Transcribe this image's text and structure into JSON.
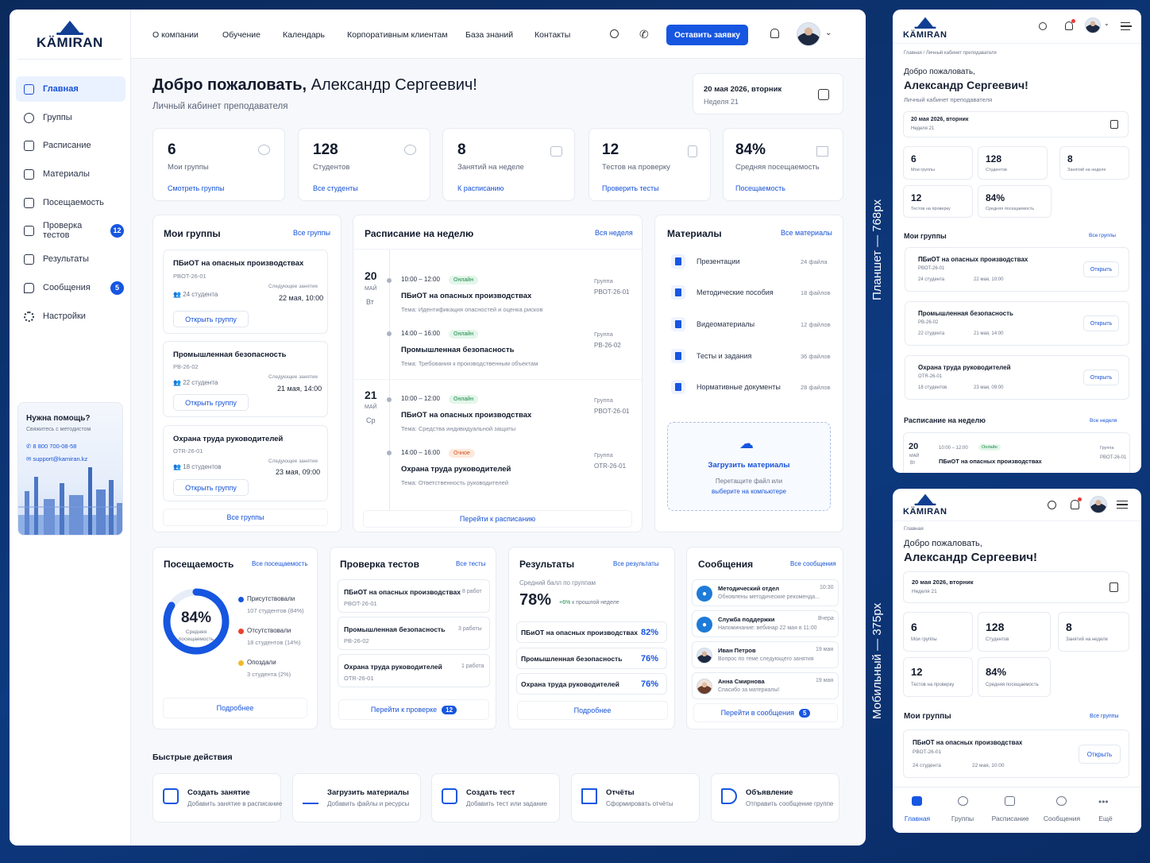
{
  "brand": {
    "name": "KÄMIRAN",
    "accent": "#1656e0"
  },
  "desktop": {
    "sidebar": {
      "items": [
        {
          "label": "Главная",
          "icon": "home-icon"
        },
        {
          "label": "Группы",
          "icon": "users-icon"
        },
        {
          "label": "Расписание",
          "icon": "calendar-icon"
        },
        {
          "label": "Материалы",
          "icon": "folder-icon"
        },
        {
          "label": "Посещаемость",
          "icon": "clipboard-icon"
        },
        {
          "label": "Проверка тестов",
          "icon": "check-square-icon",
          "badge": "12"
        },
        {
          "label": "Результаты",
          "icon": "bar-chart-icon"
        },
        {
          "label": "Сообщения",
          "icon": "chat-icon",
          "badge": "5"
        },
        {
          "label": "Настройки",
          "icon": "gear-icon"
        }
      ],
      "help": {
        "title": "Нужна помощь?",
        "subtitle": "Свяжитесь с методистом",
        "phone": "8 800 700-08-58",
        "email": "support@kamiran.kz"
      }
    },
    "topnav": {
      "links": [
        "О компании",
        "Обучение",
        "Календарь",
        "Корпоративным клиентам",
        "База знаний",
        "Контакты"
      ],
      "cta": "Оставить заявку"
    },
    "welcome": {
      "greeting": "Добро пожаловать,",
      "name": "Александр Сергеевич!",
      "subtitle": "Личный кабинет преподавателя"
    },
    "date": {
      "line1": "20 мая 2026, вторник",
      "line2": "Неделя 21"
    },
    "stats": [
      {
        "value": "6",
        "label": "Мои группы",
        "link": "Смотреть группы"
      },
      {
        "value": "128",
        "label": "Студентов",
        "link": "Все студенты"
      },
      {
        "value": "8",
        "label": "Занятий на неделе",
        "link": "К расписанию"
      },
      {
        "value": "12",
        "label": "Тестов на проверку",
        "link": "Проверить тесты"
      },
      {
        "value": "84%",
        "label": "Средняя посещаемость",
        "link": "Посещаемость"
      }
    ],
    "groups": {
      "title": "Мои группы",
      "all": "Все группы",
      "items": [
        {
          "name": "ПБиОТ на опасных производствах",
          "code": "PBOT-26-01",
          "students": "24 студента",
          "next_label": "Следующее занятие",
          "next": "22 мая, 10:00",
          "btn": "Открыть группу"
        },
        {
          "name": "Промышленная безопасность",
          "code": "PB-26-02",
          "students": "22 студента",
          "next_label": "Следующее занятие",
          "next": "21 мая, 14:00",
          "btn": "Открыть группу"
        },
        {
          "name": "Охрана труда руководителей",
          "code": "OTR-26-01",
          "students": "18 студентов",
          "next_label": "Следующее занятие",
          "next": "23 мая, 09:00",
          "btn": "Открыть группу"
        }
      ],
      "footer": "Все группы"
    },
    "schedule": {
      "title": "Расписание на неделю",
      "all": "Вся неделя",
      "days": [
        {
          "day": "20",
          "month": "МАЙ",
          "wd": "Вт",
          "lessons": [
            {
              "time": "10:00 – 12:00",
              "mode": "Онлайн",
              "title": "ПБиОТ на опасных производствах",
              "topic": "Тема: Идентификация опасностей и оценка рисков",
              "group_label": "Группа",
              "group": "PBOT-26-01"
            },
            {
              "time": "14:00 – 16:00",
              "mode": "Онлайн",
              "title": "Промышленная безопасность",
              "topic": "Тема: Требования к производственным объектам",
              "group_label": "Группа",
              "group": "PB-26-02"
            }
          ]
        },
        {
          "day": "21",
          "month": "МАЙ",
          "wd": "Ср",
          "lessons": [
            {
              "time": "10:00 – 12:00",
              "mode": "Онлайн",
              "title": "ПБиОТ на опасных производствах",
              "topic": "Тема: Средства индивидуальной защиты",
              "group_label": "Группа",
              "group": "PBOT-26-01"
            },
            {
              "time": "14:00 – 16:00",
              "mode": "Очное",
              "title": "Охрана труда руководителей",
              "topic": "Тема: Ответственность руководителей",
              "group_label": "Группа",
              "group": "OTR-26-01"
            }
          ]
        }
      ],
      "footer": "Перейти к расписанию"
    },
    "materials": {
      "title": "Материалы",
      "all": "Все материалы",
      "items": [
        {
          "name": "Презентации",
          "count": "24 файла"
        },
        {
          "name": "Методические пособия",
          "count": "18 файлов"
        },
        {
          "name": "Видеоматериалы",
          "count": "12 файлов"
        },
        {
          "name": "Тесты и задания",
          "count": "36 файлов"
        },
        {
          "name": "Нормативные документы",
          "count": "28 файлов"
        }
      ],
      "upload_title": "Загрузить материалы",
      "upload_hint1": "Перетащите файл или",
      "upload_hint2": "выберите на компьютере"
    },
    "attendance": {
      "title": "Посещаемость",
      "all": "Все посещаемость",
      "percent": "84%",
      "percent_value": 84,
      "center_label1": "Средняя",
      "center_label2": "посещаемость",
      "legend": [
        {
          "name": "Присутствовали",
          "detail": "107 студентов (84%)",
          "color": "#1656e0"
        },
        {
          "name": "Отсутствовали",
          "detail": "18 студентов (14%)",
          "color": "#e8412e"
        },
        {
          "name": "Опоздали",
          "detail": "3 студента (2%)",
          "color": "#f2b92b"
        }
      ],
      "footer": "Подробнее"
    },
    "tests": {
      "title": "Проверка тестов",
      "all": "Все тесты",
      "items": [
        {
          "name": "ПБиОТ на опасных производствах",
          "code": "PBOT-26-01",
          "count": "8 работ"
        },
        {
          "name": "Промышленная безопасность",
          "code": "PB-26-02",
          "count": "3 работы"
        },
        {
          "name": "Охрана труда руководителей",
          "code": "OTR-26-01",
          "count": "1 работа"
        }
      ],
      "footer": "Перейти к проверке",
      "footer_badge": "12"
    },
    "results": {
      "title": "Результаты",
      "all": "Все результаты",
      "avg_label": "Средний балл по группам",
      "avg": "78%",
      "delta": "+6%",
      "delta_label": "к прошлой неделе",
      "items": [
        {
          "name": "ПБиОТ на опасных производствах",
          "pct": "82%"
        },
        {
          "name": "Промышленная безопасность",
          "pct": "76%"
        },
        {
          "name": "Охрана труда руководителей",
          "pct": "76%"
        }
      ],
      "footer": "Подробнее"
    },
    "messages": {
      "title": "Сообщения",
      "all": "Все сообщения",
      "items": [
        {
          "from": "Методический отдел",
          "time": "10:30",
          "text": "Обновлены методические рекоменда..."
        },
        {
          "from": "Служба поддержки",
          "time": "Вчера",
          "text": "Напоминание: вебинар 22 мая в 11:00"
        },
        {
          "from": "Иван Петров",
          "time": "19 мая",
          "text": "Вопрос по теме следующего занятия"
        },
        {
          "from": "Анна Смирнова",
          "time": "19 мая",
          "text": "Спасибо за материалы!"
        }
      ],
      "footer": "Перейти в сообщения",
      "footer_badge": "5"
    },
    "quick": {
      "title": "Быстрые действия",
      "items": [
        {
          "title": "Создать занятие",
          "sub": "Добавить занятие в расписание"
        },
        {
          "title": "Загрузить материалы",
          "sub": "Добавить файлы и ресурсы"
        },
        {
          "title": "Создать тест",
          "sub": "Добавить тест или задание"
        },
        {
          "title": "Отчёты",
          "sub": "Сформировать отчёты"
        },
        {
          "title": "Объявление",
          "sub": "Отправить сообщение группе"
        }
      ]
    }
  },
  "labels": {
    "tablet": "Планшет — 768px",
    "mobile": "Мобильный — 375px"
  },
  "tablet": {
    "breadcrumb": "Главная  /  Личный кабинет преподавателя",
    "greet1": "Добро пожаловать,",
    "greet2": "Александр Сергеевич!",
    "sub": "Личный кабинет преподавателя",
    "date1": "20 мая 2026, вторник",
    "date2": "Неделя 21",
    "stats": [
      {
        "value": "6",
        "label": "Мои группы"
      },
      {
        "value": "128",
        "label": "Студентов"
      },
      {
        "value": "8",
        "label": "Занятий на неделе"
      },
      {
        "value": "12",
        "label": "Тестов на проверку"
      },
      {
        "value": "84%",
        "label": "Средняя посещаемость"
      }
    ],
    "groups_title": "Мои группы",
    "groups_all": "Все группы",
    "groups": [
      {
        "name": "ПБиОТ на опасных производствах",
        "code": "PBOT-26-01",
        "students": "24 студента",
        "next": "22 мая, 10:00"
      },
      {
        "name": "Промышленная безопасность",
        "code": "PB-26-02",
        "students": "22 студента",
        "next": "21 мая, 14:00"
      },
      {
        "name": "Охрана труда руководителей",
        "code": "OTR-26-01",
        "students": "18 студентов",
        "next": "23 мая, 09:00"
      }
    ],
    "open": "Открыть",
    "sched_title": "Расписание на неделю",
    "sched_all": "Все неделя",
    "sched": {
      "day": "20",
      "month": "МАЙ",
      "wd": "Вт",
      "time": "10:00 – 12:00",
      "mode": "Онлайн",
      "title": "ПБиОТ на опасных производствах",
      "group_label": "Группа",
      "group": "PBOT-26-01"
    }
  },
  "mobile": {
    "breadcrumb": "Главная",
    "greet1": "Добро пожаловать,",
    "greet2": "Александр Сергеевич!",
    "date1": "20 мая 2026, вторник",
    "date2": "Неделя 21",
    "stats": [
      {
        "value": "6",
        "label": "Мои группы"
      },
      {
        "value": "128",
        "label": "Студентов"
      },
      {
        "value": "8",
        "label": "Занятий на неделе"
      },
      {
        "value": "12",
        "label": "Тестов на проверку"
      },
      {
        "value": "84%",
        "label": "Средняя посещаемость"
      }
    ],
    "groups_title": "Мои группы",
    "groups_all": "Все группы",
    "group": {
      "name": "ПБиОТ на опасных производствах",
      "code": "PBOT-26-01",
      "students": "24 студента",
      "next": "22 мая, 10:00"
    },
    "open": "Открыть",
    "tabs": [
      "Главная",
      "Группы",
      "Расписание",
      "Сообщения",
      "Ещё"
    ]
  }
}
